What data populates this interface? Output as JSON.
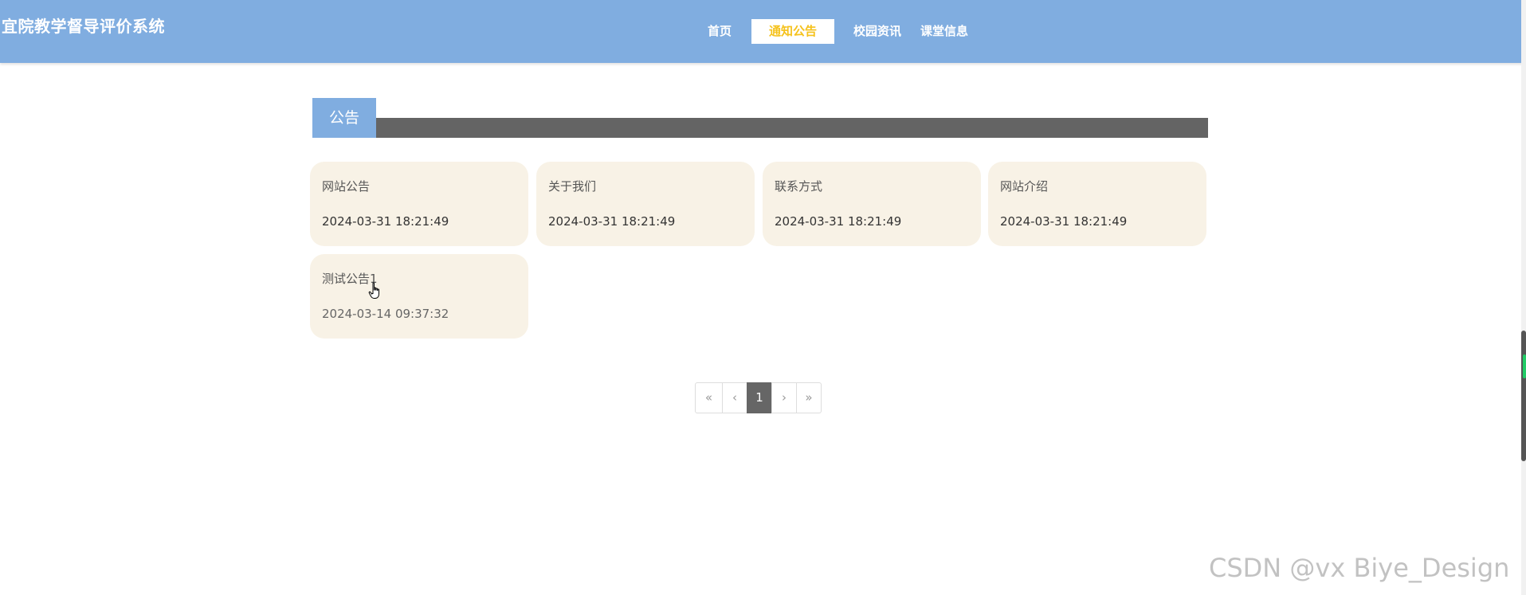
{
  "header": {
    "site_title": "宜院教学督导评价系统",
    "nav": [
      {
        "label": "首页",
        "active": false
      },
      {
        "label": "通知公告",
        "active": true
      },
      {
        "label": "校园资讯",
        "active": false
      },
      {
        "label": "课堂信息",
        "active": false
      }
    ]
  },
  "section": {
    "title": "公告"
  },
  "notices": [
    {
      "title": "网站公告",
      "date": "2024-03-31 18:21:49"
    },
    {
      "title": "关于我们",
      "date": "2024-03-31 18:21:49"
    },
    {
      "title": "联系方式",
      "date": "2024-03-31 18:21:49"
    },
    {
      "title": "网站介绍",
      "date": "2024-03-31 18:21:49"
    },
    {
      "title": "测试公告1",
      "date": "2024-03-14 09:37:32"
    }
  ],
  "pagination": {
    "first": "«",
    "prev": "‹",
    "current": "1",
    "next": "›",
    "last": "»"
  },
  "watermark": "CSDN @vx  Biye_Design",
  "colors": {
    "header_bg": "#80ade0",
    "nav_active_text": "#f5c21c",
    "section_bar": "#646464",
    "card_bg": "#f8f2e6",
    "page_current_bg": "#666666"
  },
  "icons": {
    "cursor": "hand-pointer-icon"
  }
}
